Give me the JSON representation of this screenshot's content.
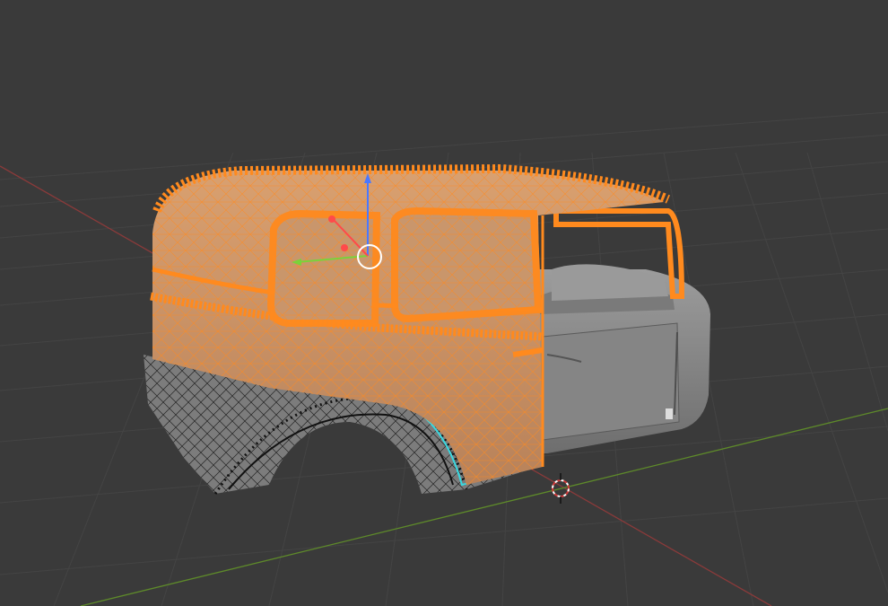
{
  "viewport": {
    "mode": "edit-mode",
    "background_color": "#3a3a3a",
    "grid_color": "#434343",
    "x_axis_color": "#8a3a3a",
    "y_axis_color": "#5e8a2a",
    "selection_color": "#ff8a1e",
    "unselected_wire_color": "#111111",
    "seam_color": "#3ad8e0",
    "body_color": "#8a8a8a"
  },
  "gizmo": {
    "z_axis_color": "#4a78ff",
    "x_axis_color": "#ff4a4a",
    "y_axis_color": "#7ad23a"
  },
  "icons": [
    "3d-cursor-icon",
    "transform-gizmo-icon"
  ]
}
